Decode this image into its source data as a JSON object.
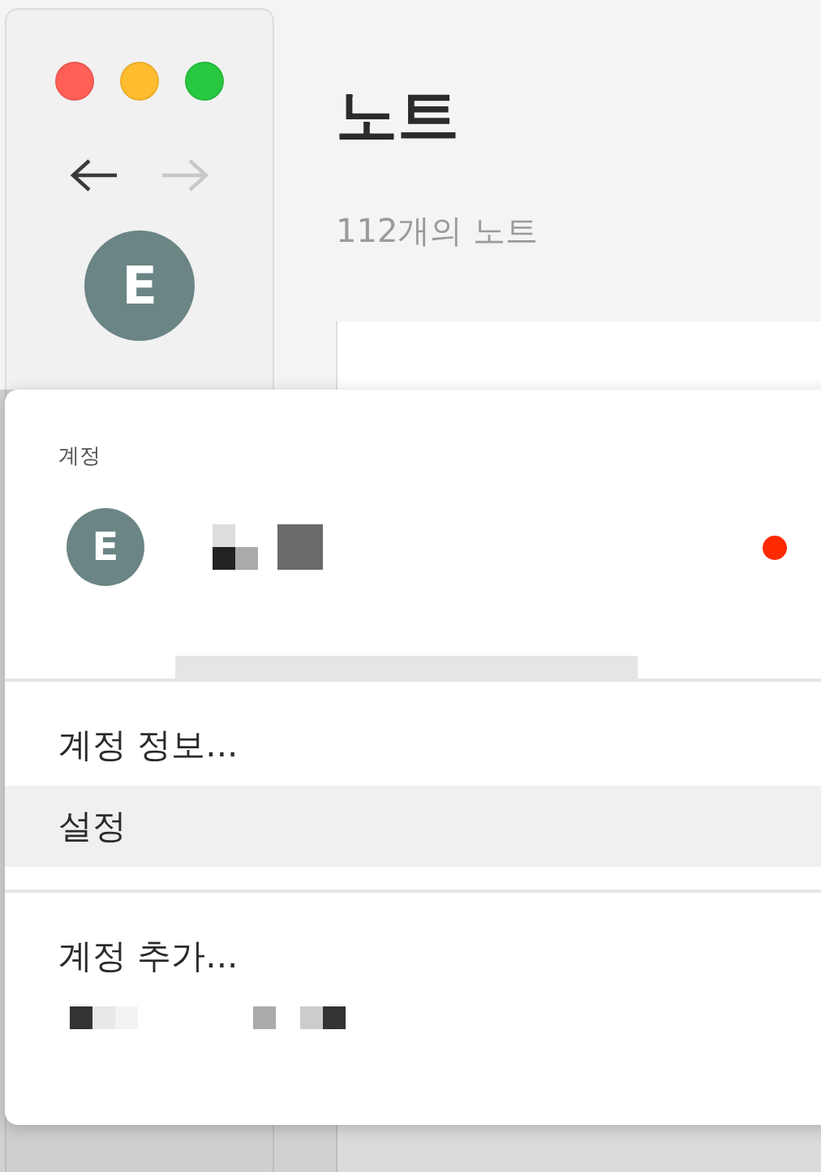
{
  "window": {
    "controls": [
      {
        "color": "#ff5f57"
      },
      {
        "color": "#febc2e"
      },
      {
        "color": "#28c840"
      }
    ]
  },
  "navigation": {
    "back_disabled": false,
    "forward_disabled": true
  },
  "sidebar": {
    "avatar": "E"
  },
  "header": {
    "title": "노트",
    "count": "112개의 노트"
  },
  "account_menu": {
    "heading": "계정",
    "account": {
      "avatar": "E",
      "has_alert": true
    },
    "sections": [
      {
        "items": [
          {
            "label": "계정 정보...",
            "selected": false
          },
          {
            "label": "설정",
            "selected": true
          }
        ]
      },
      {
        "items": [
          {
            "label": "계정 추가...",
            "selected": false
          }
        ]
      }
    ]
  }
}
